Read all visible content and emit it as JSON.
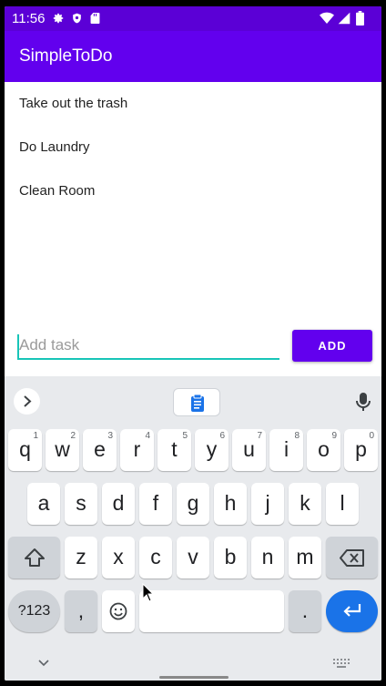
{
  "status_bar": {
    "time": "11:56",
    "left_icons": [
      "gear-icon",
      "shield-icon",
      "sd-card-icon"
    ],
    "right_icons": [
      "wifi-icon",
      "signal-icon",
      "battery-icon"
    ]
  },
  "app": {
    "title": "SimpleToDo",
    "accent_color": "#6200ee",
    "input_underline_color": "#18c5b8"
  },
  "tasks": [
    "Take out the trash",
    "Do Laundry",
    "Clean Room"
  ],
  "add_row": {
    "placeholder": "Add task",
    "value": "",
    "button_label": "ADD"
  },
  "keyboard": {
    "toolbar": {
      "expand_icon": "chevron-right-icon",
      "clipboard_icon": "clipboard-icon",
      "mic_icon": "mic-icon"
    },
    "row1": [
      {
        "key": "q",
        "hint": "1"
      },
      {
        "key": "w",
        "hint": "2"
      },
      {
        "key": "e",
        "hint": "3"
      },
      {
        "key": "r",
        "hint": "4"
      },
      {
        "key": "t",
        "hint": "5"
      },
      {
        "key": "y",
        "hint": "6"
      },
      {
        "key": "u",
        "hint": "7"
      },
      {
        "key": "i",
        "hint": "8"
      },
      {
        "key": "o",
        "hint": "9"
      },
      {
        "key": "p",
        "hint": "0"
      }
    ],
    "row2": [
      "a",
      "s",
      "d",
      "f",
      "g",
      "h",
      "j",
      "k",
      "l"
    ],
    "row3": [
      "z",
      "x",
      "c",
      "v",
      "b",
      "n",
      "m"
    ],
    "symbols_label": "?123",
    "comma_label": ",",
    "period_label": ".",
    "space_label": ""
  }
}
